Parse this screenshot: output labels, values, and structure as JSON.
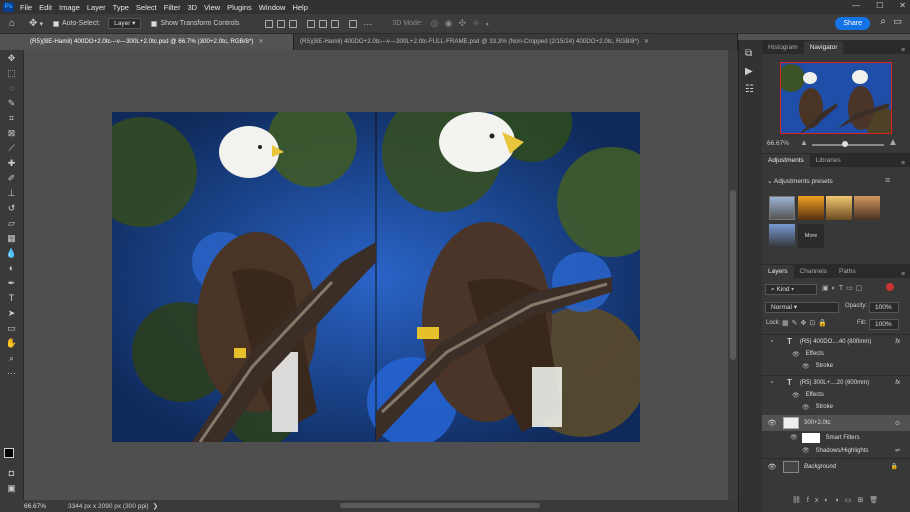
{
  "menubar": {
    "logo": "Ps",
    "items": [
      "File",
      "Edit",
      "Image",
      "Layer",
      "Type",
      "Select",
      "Filter",
      "3D",
      "View",
      "Plugins",
      "Window",
      "Help"
    ],
    "window_controls": [
      "—",
      "☐",
      "✕"
    ]
  },
  "options": {
    "auto_select_label": "Auto-Select:",
    "auto_select_value": "Layer",
    "show_transform_label": "Show Transform Controls",
    "mode_3d": "3D Mode:",
    "share_label": "Share"
  },
  "tabs": [
    {
      "label": "(R5)(BE-Hamil) 400DO+2.0tc---v---300L+2.0tc.psd @ 66.7% (300+2.0tc, RGB/8*)",
      "active": true
    },
    {
      "label": "(R5)(BE-Hamil) 400DO+2.0tc---v---300L+2.0tc-FULL-FRAME.psd @ 33.3% (Non-Cropped (2/15/24) 400DO+2.0tc, RGB/8*)",
      "active": false
    }
  ],
  "status": {
    "zoom": "66.67%",
    "doc_info": "3344 px x 2090 px (300 ppi)"
  },
  "navigator": {
    "tabs": [
      "Histogram",
      "Navigator"
    ],
    "active_tab": "Navigator",
    "zoom": "66.67%"
  },
  "adjustments": {
    "tabs": [
      "Adjustments",
      "Libraries"
    ],
    "active_tab": "Adjustments",
    "presets_label": "Adjustments presets",
    "more_label": "More"
  },
  "layers_panel": {
    "tabs": [
      "Layers",
      "Channels",
      "Paths"
    ],
    "active_tab": "Layers",
    "kind_label": "Kind",
    "blend_mode": "Normal",
    "opacity_label": "Opacity:",
    "opacity_value": "100%",
    "lock_label": "Lock:",
    "fill_label": "Fill:",
    "fill_value": "100%",
    "layers": [
      {
        "name": "(R5) 400DO....40 (800mm)",
        "type": "text",
        "visible": false
      },
      {
        "name": "Effects",
        "type": "sub",
        "visible": true
      },
      {
        "name": "Stroke",
        "type": "sub2",
        "visible": true
      },
      {
        "name": "(R5) 300L+....20 (600mm)",
        "type": "text",
        "visible": false
      },
      {
        "name": "Effects",
        "type": "sub",
        "visible": true
      },
      {
        "name": "Stroke",
        "type": "sub2",
        "visible": true
      },
      {
        "name": "300+2.0tc",
        "type": "smart",
        "visible": true,
        "selected": true
      },
      {
        "name": "Smart Filters",
        "type": "sub",
        "visible": true
      },
      {
        "name": "Shadows/Highlights",
        "type": "sub2",
        "visible": true
      },
      {
        "name": "Background",
        "type": "bg",
        "visible": true
      }
    ],
    "fx_label": "fx"
  },
  "colors": {
    "accent": "#1473e6",
    "panel_bg": "#383838",
    "canvas_bg": "#535353"
  }
}
